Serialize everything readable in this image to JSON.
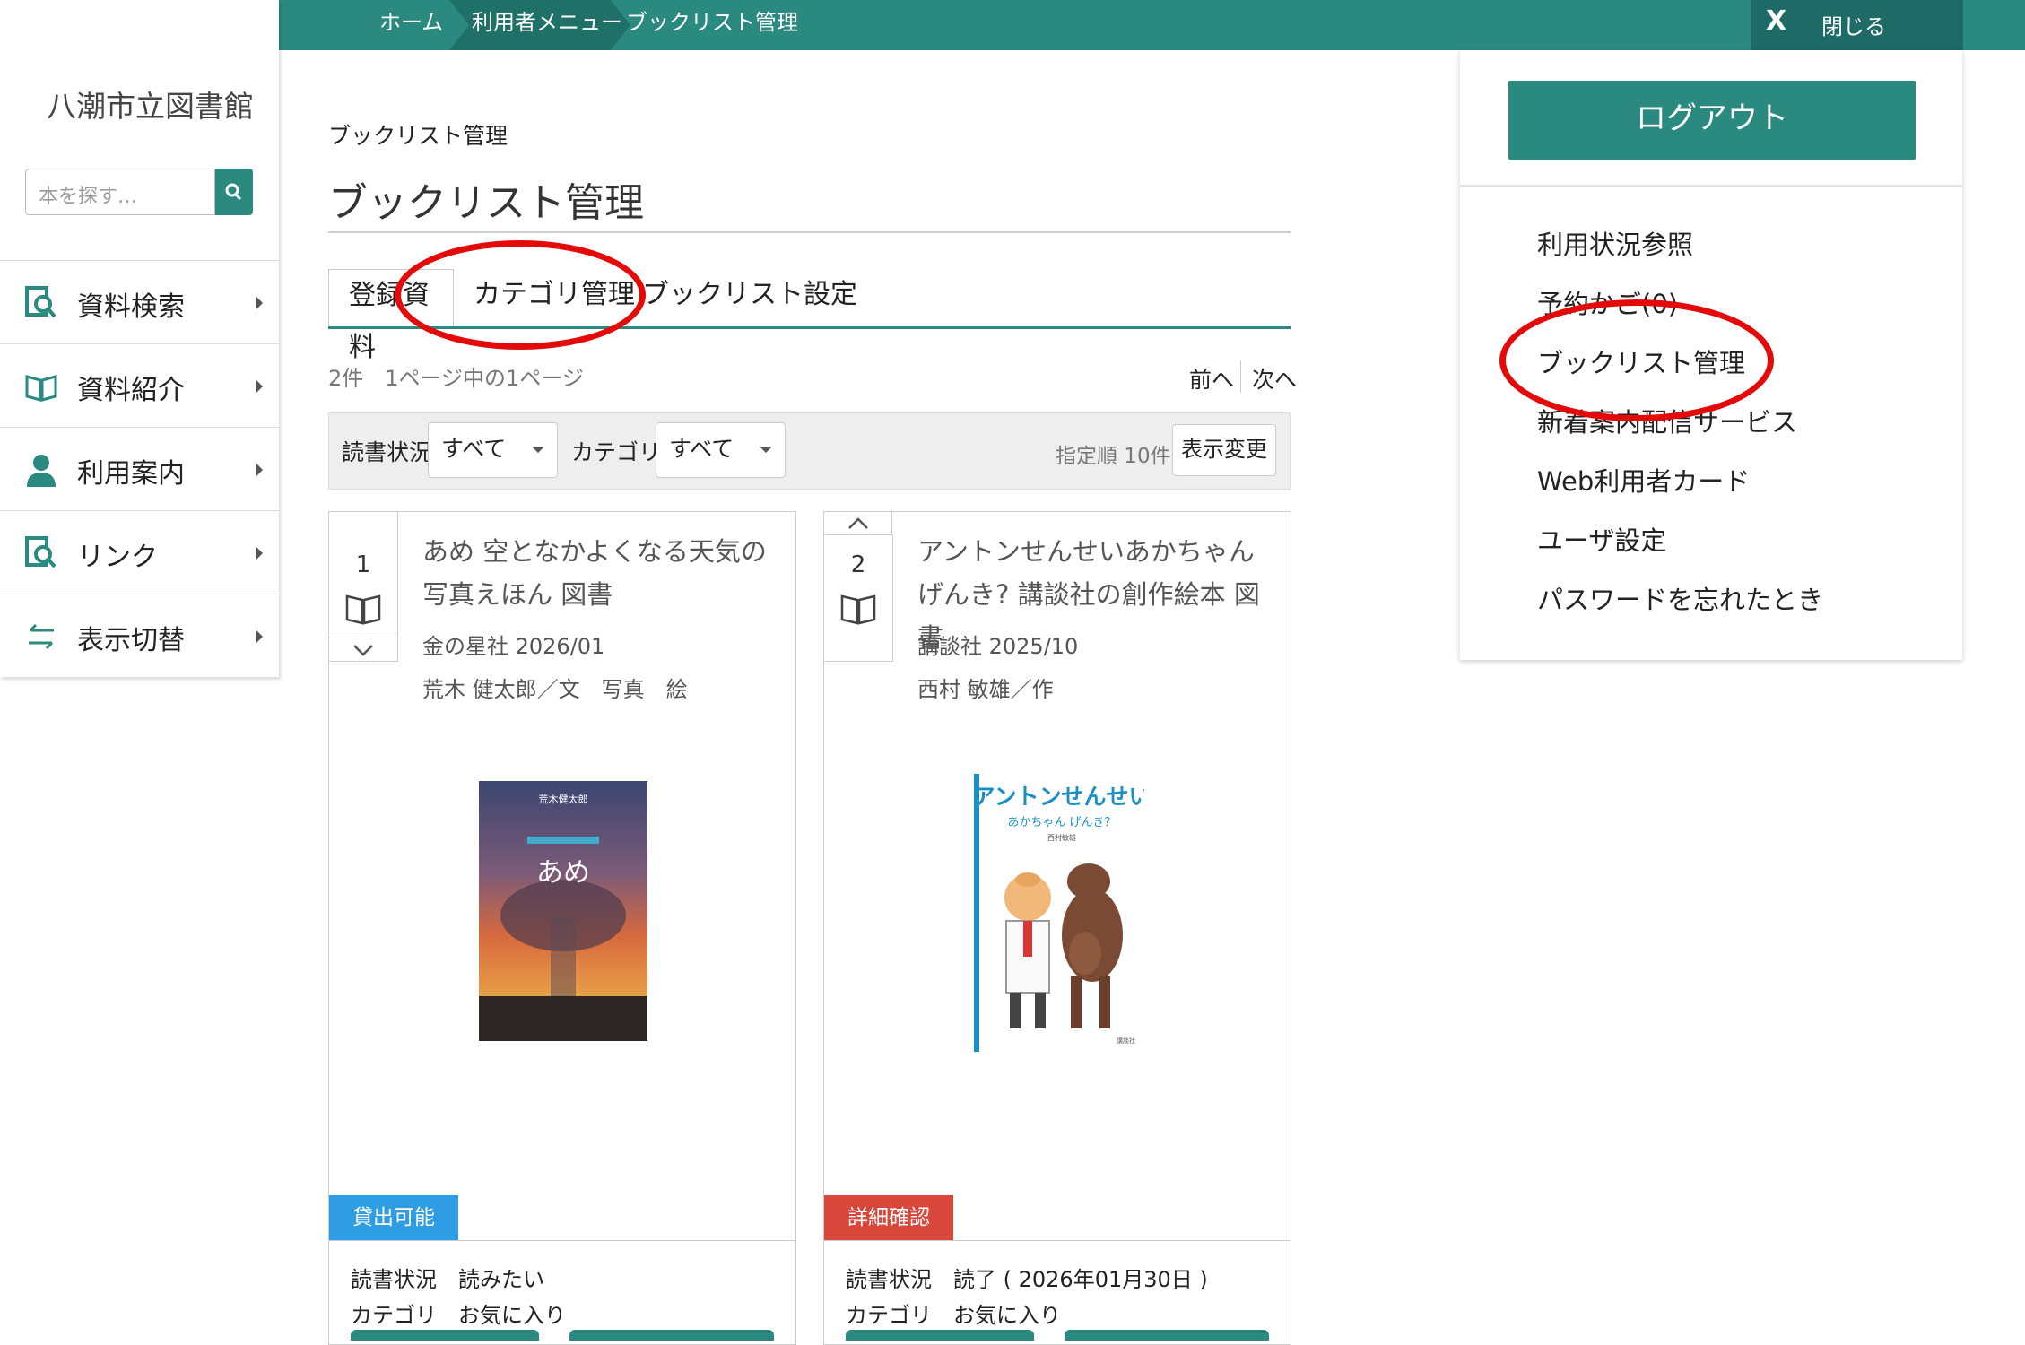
{
  "breadcrumb": [
    "ホーム",
    "利用者メニュー",
    "ブックリスト管理"
  ],
  "close": {
    "icon": "x-icon",
    "label": "閉じる"
  },
  "sidebar": {
    "library_name": "八潮市立図書館",
    "search_placeholder": "本を探す…",
    "items": [
      {
        "label": "資料検索",
        "icon": "search-book-icon"
      },
      {
        "label": "資料紹介",
        "icon": "open-book-icon"
      },
      {
        "label": "利用案内",
        "icon": "person-icon"
      },
      {
        "label": "リンク",
        "icon": "search-book-icon"
      },
      {
        "label": "表示切替",
        "icon": "switch-arrows-icon"
      }
    ]
  },
  "main": {
    "small_title": "ブックリスト管理",
    "title": "ブックリスト管理",
    "tabs": [
      "登録資料",
      "カテゴリ管理",
      "ブックリスト設定"
    ],
    "count_text": "2件　1ページ中の1ページ",
    "prev": "前へ",
    "next": "次へ",
    "filter": {
      "status_label": "読書状況",
      "status_value": "すべて",
      "category_label": "カテゴリ",
      "category_value": "すべて",
      "sort_text": "指定順 10件",
      "apply_button": "表示変更"
    }
  },
  "cards": [
    {
      "number": "1",
      "title": "あめ 空となかよくなる天気の写真えほん 図書",
      "publisher": "金の星社 2026/01",
      "author": "荒木 健太郎／文　写真　絵",
      "badge": "貸出可能",
      "badge_color": "#2f9de4",
      "status_label": "読書状況",
      "status_value": "読みたい",
      "category_label": "カテゴリ",
      "category_value": "お気に入り",
      "cover_text": "あめ",
      "cover_author": "荒木健太郎"
    },
    {
      "number": "2",
      "title": "アントンせんせいあかちゃんげんき? 講談社の創作絵本 図書",
      "publisher": "講談社 2025/10",
      "author": "西村 敏雄／作",
      "badge": "詳細確認",
      "badge_color": "#d9473b",
      "status_label": "読書状況",
      "status_value": "読了 ( 2026年01月30日 )",
      "category_label": "カテゴリ",
      "category_value": "お気に入り",
      "cover_text": "アントンせんせい",
      "cover_subtitle": "あかちゃん げんき？",
      "cover_author": "西村敏雄"
    }
  ],
  "panel": {
    "logout": "ログアウト",
    "links": [
      "利用状況参照",
      "予約かご(0)",
      "ブックリスト管理",
      "新着案内配信サービス",
      "Web利用者カード",
      "ユーザ設定",
      "パスワードを忘れたとき"
    ]
  },
  "colors": {
    "teal": "#2a8a80",
    "highlight": "#e30a0a"
  }
}
